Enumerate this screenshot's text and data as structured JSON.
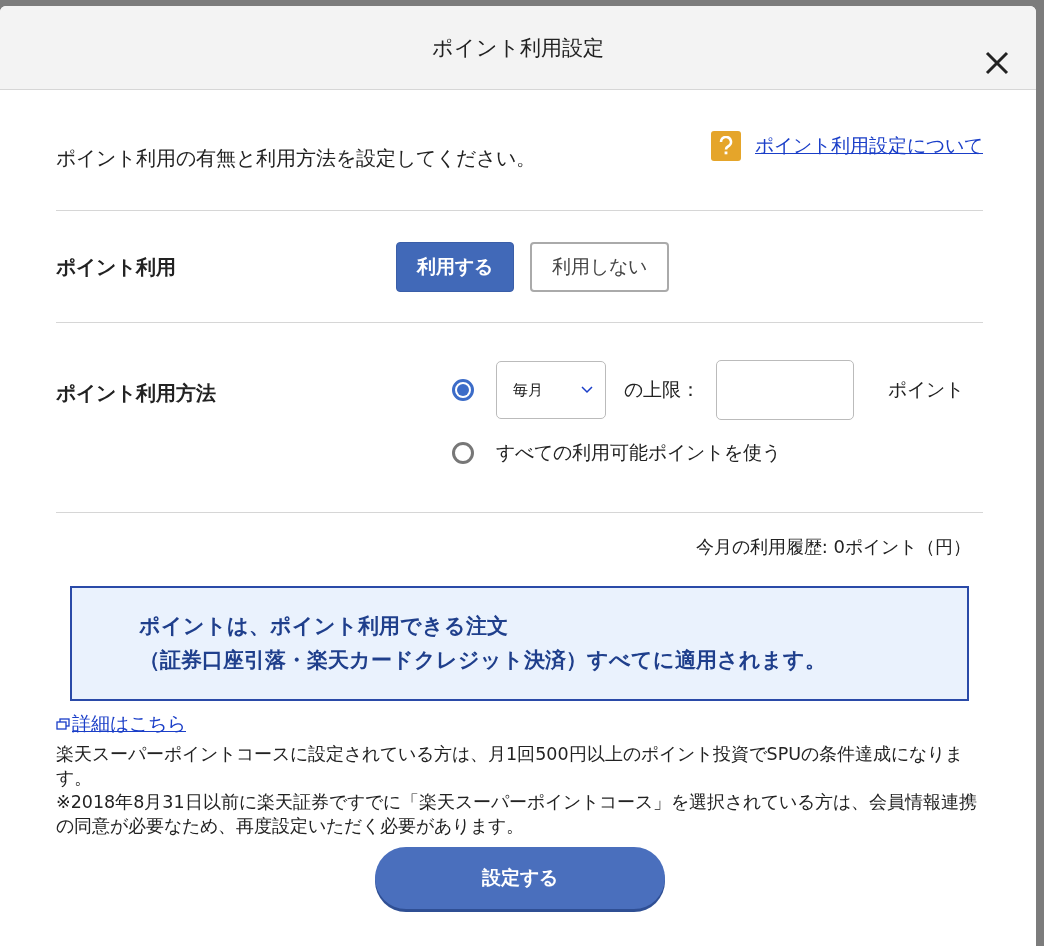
{
  "dialog": {
    "title": "ポイント利用設定"
  },
  "intro": "ポイント利用の有無と利用方法を設定してください。",
  "help_link": "ポイント利用設定について",
  "usage": {
    "label": "ポイント利用",
    "options": [
      {
        "label": "利用する",
        "selected": true
      },
      {
        "label": "利用しない",
        "selected": false
      }
    ]
  },
  "method": {
    "label": "ポイント利用方法",
    "options": [
      {
        "kind": "limit",
        "selected": true,
        "period": "毎月",
        "text": "の上限：",
        "unit": "ポイント"
      },
      {
        "kind": "all",
        "selected": false,
        "text": "すべての利用可能ポイントを使う"
      }
    ]
  },
  "history": "今月の利用履歴: 0ポイント（円）",
  "notice": [
    "ポイントは、ポイント利用できる注文",
    "（証券口座引落・楽天カードクレジット決済）すべてに適用されます。"
  ],
  "details_link": "詳細はこちら",
  "notes": [
    "楽天スーパーポイントコースに設定されている方は、月1回500円以上のポイント投資でSPUの条件達成になります。",
    "※2018年8月31日以前に楽天証券ですでに「楽天スーパーポイントコース」を選択されている方は、会員情報連携の同意が必要なため、再度設定いただく必要があります。"
  ],
  "submit": "設定する"
}
